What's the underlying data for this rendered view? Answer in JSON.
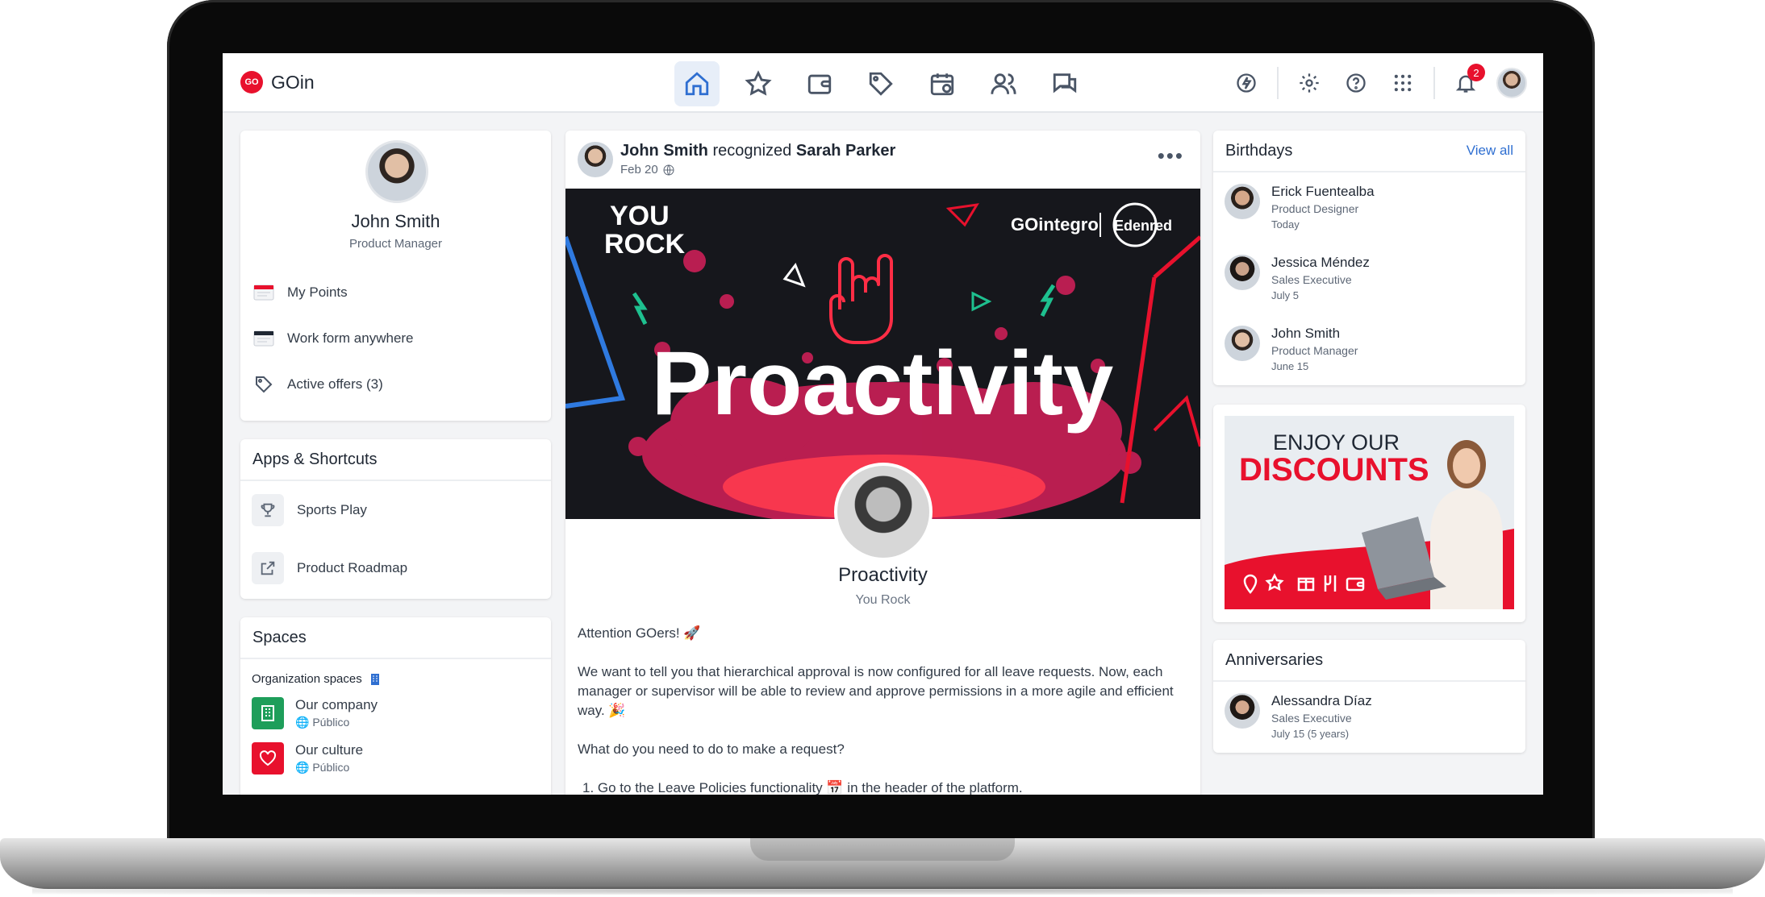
{
  "topbar": {
    "brand_logo": "GO",
    "brand_name": "GOin",
    "notifications_count": "2",
    "nav_icons": [
      "home-icon",
      "star-icon",
      "wallet-icon",
      "tag-icon",
      "calendar-icon",
      "users-icon",
      "chat-icon"
    ],
    "tool_icons": [
      "quick-action-icon",
      "gear-icon",
      "help-icon",
      "apps-grid-icon",
      "bell-icon"
    ]
  },
  "profile": {
    "name": "John Smith",
    "role": "Product Manager",
    "menu": [
      {
        "label": "My Points",
        "icon": "calendar-red-icon"
      },
      {
        "label": "Work form anywhere",
        "icon": "calendar-dark-icon"
      },
      {
        "label": "Active offers (3)",
        "icon": "tag-icon"
      }
    ]
  },
  "apps": {
    "title": "Apps & Shortcuts",
    "items": [
      {
        "label": "Sports Play",
        "icon": "trophy-icon"
      },
      {
        "label": "Product Roadmap",
        "icon": "external-link-icon"
      }
    ]
  },
  "spaces": {
    "title": "Spaces",
    "org_label": "Organization spaces",
    "items": [
      {
        "title": "Our company",
        "visibility": "Público",
        "color": "#1e9e5a",
        "icon": "building-icon"
      },
      {
        "title": "Our culture",
        "visibility": "Público",
        "color": "#e8112d",
        "icon": "heart-icon"
      }
    ]
  },
  "post": {
    "author": "John Smith",
    "verb": "recognized",
    "target": "Sarah Parker",
    "date": "Feb 20",
    "banner": {
      "badge_line1": "YOU",
      "badge_line2": "ROCK",
      "brand_left": "GOintegro",
      "brand_right": "Edenred",
      "headline": "Proactivity"
    },
    "recognition_name": "Proactivity",
    "recognition_sub": "You Rock",
    "body": [
      "Attention GOers! 🚀",
      "We want to tell you that hierarchical approval is now configured for all leave requests. Now, each manager or supervisor will be able to review and approve permissions in a more agile and efficient way. 🎉",
      "What do you need to do to make a request?",
      "1. Go to the Leave Policies functionality 📅 in the header of the platform."
    ]
  },
  "birthdays": {
    "title": "Birthdays",
    "view_all": "View all",
    "people": [
      {
        "name": "Erick Fuentealba",
        "role": "Product Designer",
        "date": "Today"
      },
      {
        "name": "Jessica Méndez",
        "role": "Sales Executive",
        "date": "July 5"
      },
      {
        "name": "John Smith",
        "role": "Product Manager",
        "date": "June 15"
      }
    ]
  },
  "promo": {
    "line1": "ENJOY OUR",
    "line2": "DISCOUNTS",
    "accent": "#e8112d"
  },
  "anniversaries": {
    "title": "Anniversaries",
    "people": [
      {
        "name": "Alessandra Díaz",
        "role": "Sales Executive",
        "date": "July 15 (5 years)"
      }
    ]
  }
}
